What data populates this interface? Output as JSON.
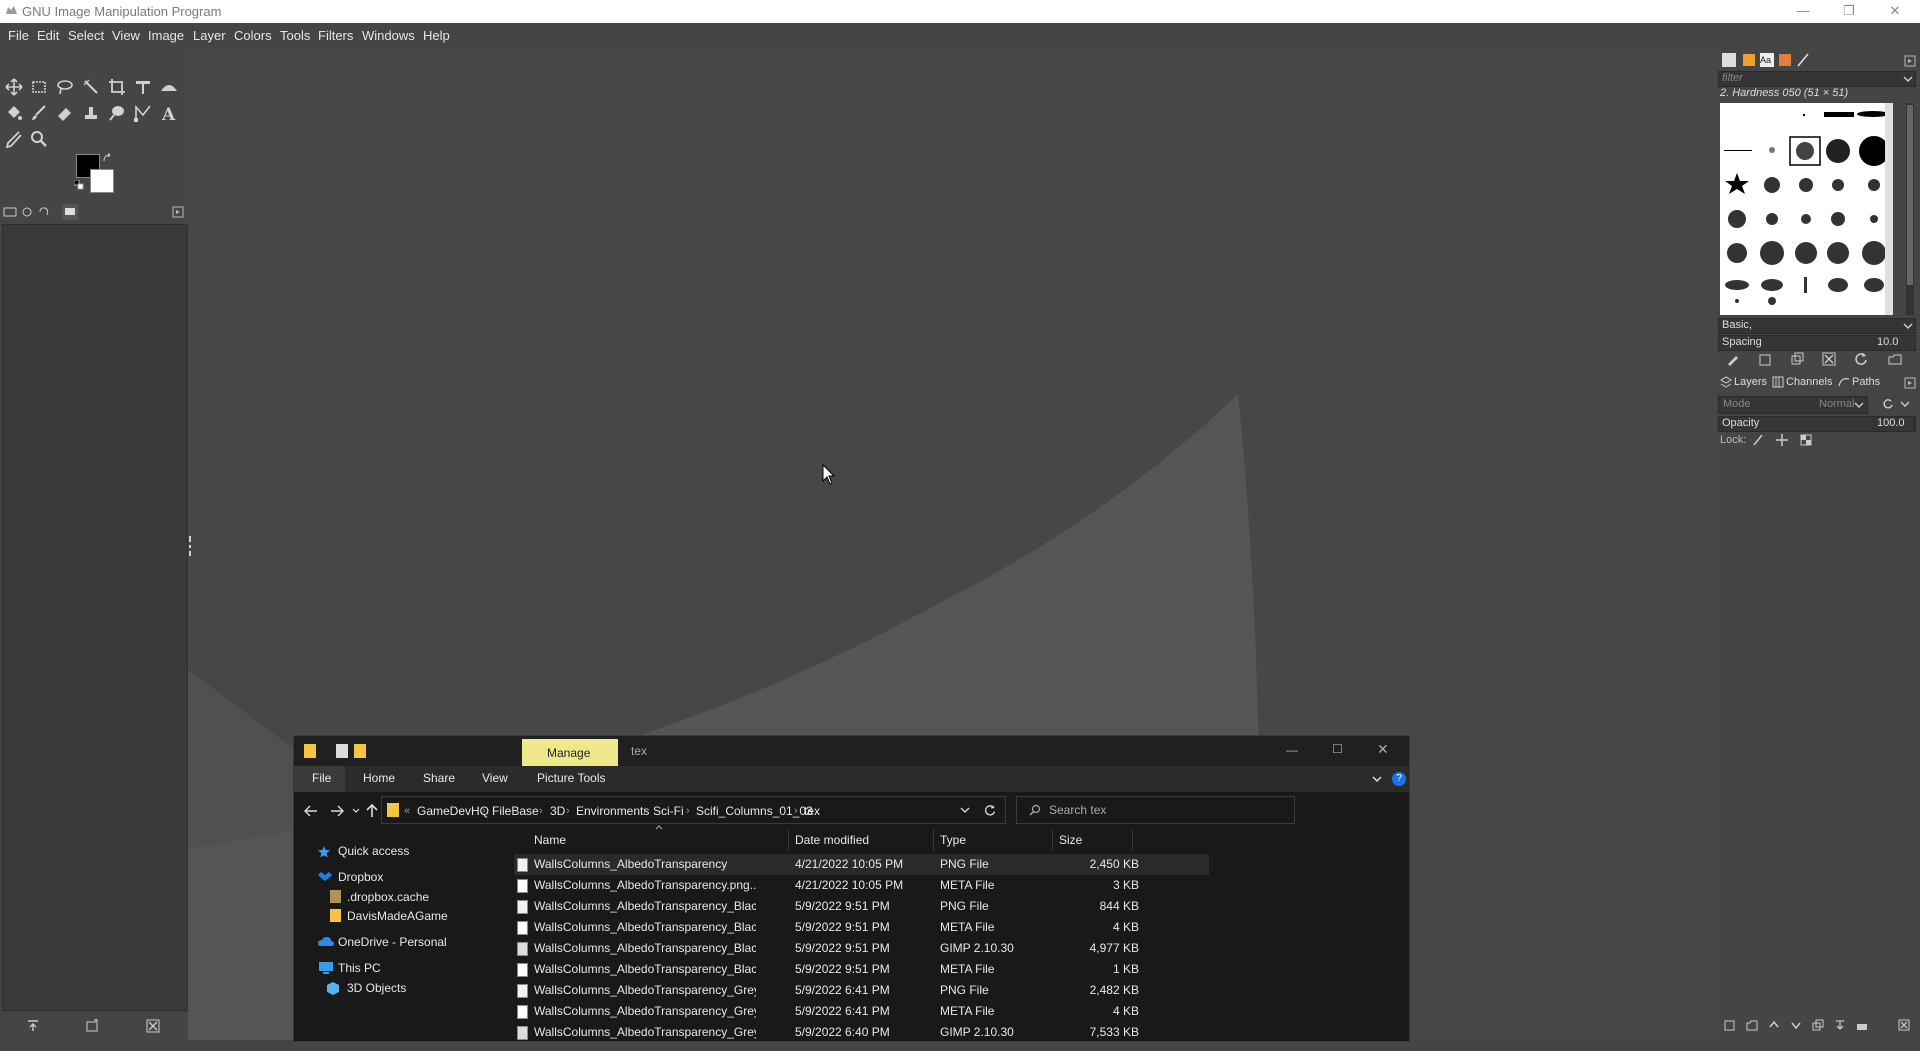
{
  "window": {
    "title": "GNU Image Manipulation Program"
  },
  "menu": [
    "File",
    "Edit",
    "Select",
    "View",
    "Image",
    "Layer",
    "Colors",
    "Tools",
    "Filters",
    "Windows",
    "Help"
  ],
  "brushes": {
    "filter_placeholder": "filter",
    "selected_brush": "2. Hardness 050 (51 × 51)",
    "preset": "Basic,",
    "spacing_label": "Spacing",
    "spacing_value": "10.0"
  },
  "layers": {
    "tabs": [
      "Layers",
      "Channels",
      "Paths"
    ],
    "mode_label": "Mode",
    "mode_value": "Normal",
    "opacity_label": "Opacity",
    "opacity_value": "100.0",
    "lock_label": "Lock:"
  },
  "explorer": {
    "manage_tab": "Manage",
    "title": "tex",
    "ribbon": [
      "File",
      "Home",
      "Share",
      "View",
      "Picture Tools"
    ],
    "breadcrumb": [
      "GameDevHQ",
      "FileBase",
      "3D",
      "Environments",
      "Sci-Fi",
      "Scifi_Columns_01_03",
      "tex"
    ],
    "search_placeholder": "Search tex",
    "nav": [
      "Quick access",
      "Dropbox",
      ".dropbox.cache",
      "DavisMadeAGame",
      "OneDrive - Personal",
      "This PC",
      "3D Objects"
    ],
    "columns": [
      "Name",
      "Date modified",
      "Type",
      "Size"
    ],
    "files": [
      {
        "name": "WallsColumns_AlbedoTransparency",
        "date": "4/21/2022 10:05 PM",
        "type": "PNG File",
        "size": "2,450 KB"
      },
      {
        "name": "WallsColumns_AlbedoTransparency.png....",
        "date": "4/21/2022 10:05 PM",
        "type": "META File",
        "size": "3 KB"
      },
      {
        "name": "WallsColumns_AlbedoTransparency_Blac...",
        "date": "5/9/2022 9:51 PM",
        "type": "PNG File",
        "size": "844 KB"
      },
      {
        "name": "WallsColumns_AlbedoTransparency_Blac...",
        "date": "5/9/2022 9:51 PM",
        "type": "META File",
        "size": "4 KB"
      },
      {
        "name": "WallsColumns_AlbedoTransparency_Blac...",
        "date": "5/9/2022 9:51 PM",
        "type": "GIMP 2.10.30",
        "size": "4,977 KB"
      },
      {
        "name": "WallsColumns_AlbedoTransparency_Blac...",
        "date": "5/9/2022 9:51 PM",
        "type": "META File",
        "size": "1 KB"
      },
      {
        "name": "WallsColumns_AlbedoTransparency_Grey...",
        "date": "5/9/2022 6:41 PM",
        "type": "PNG File",
        "size": "2,482 KB"
      },
      {
        "name": "WallsColumns_AlbedoTransparency_Grey...",
        "date": "5/9/2022 6:41 PM",
        "type": "META File",
        "size": "4 KB"
      },
      {
        "name": "WallsColumns_AlbedoTransparency_Grey...",
        "date": "5/9/2022 6:40 PM",
        "type": "GIMP 2.10.30",
        "size": "7,533 KB"
      }
    ]
  }
}
